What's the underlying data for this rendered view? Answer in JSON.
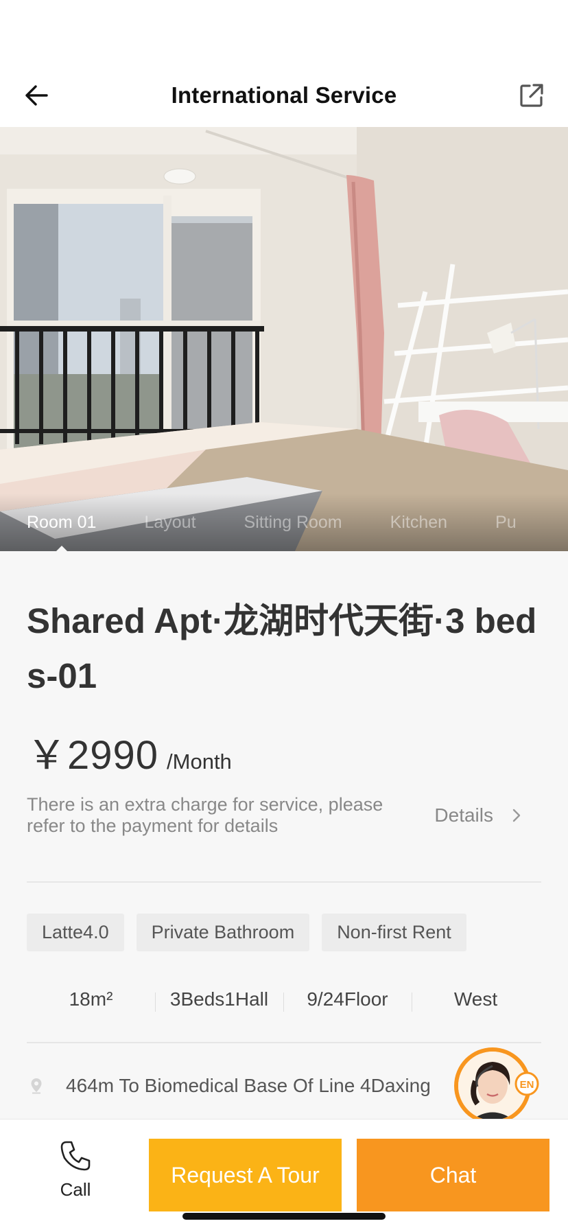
{
  "header": {
    "title": "International Service",
    "back_icon": "arrow-left-icon",
    "share_icon": "external-link-icon"
  },
  "gallery": {
    "tabs": [
      {
        "label": "Room 01",
        "active": true
      },
      {
        "label": "Layout",
        "active": false
      },
      {
        "label": "Sitting Room",
        "active": false
      },
      {
        "label": "Kitchen",
        "active": false
      },
      {
        "label": "Pu",
        "active": false
      }
    ]
  },
  "listing": {
    "title": "Shared Apt·龙湖时代天街·3 beds-01",
    "price": "￥2990",
    "price_unit": "/Month",
    "fee_note": "There is an extra charge for service, please refer to the payment for details",
    "details_label": "Details",
    "tags": [
      "Latte4.0",
      "Private Bathroom",
      "Non-first Rent"
    ],
    "specs": [
      "18m²",
      "3Beds1Hall",
      "9/24Floor",
      "West"
    ],
    "location": "464m To Biomedical Base Of Line 4Daxing"
  },
  "agent": {
    "badge": "EN"
  },
  "bottom_bar": {
    "call_label": "Call",
    "tour_label": "Request A Tour",
    "chat_label": "Chat"
  },
  "colors": {
    "tour_button": "#fbb316",
    "chat_button": "#f8961f",
    "background": "#f7f7f7"
  }
}
